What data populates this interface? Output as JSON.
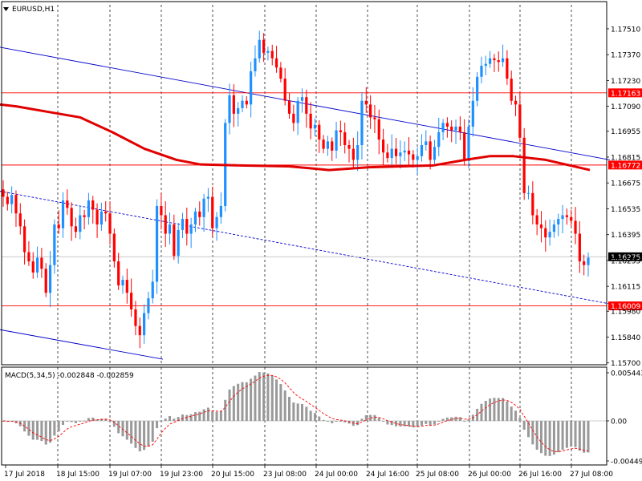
{
  "chart_data": {
    "type": "candlestick",
    "title": "EURUSD,H1",
    "price_axis": {
      "ylim": [
        1.1569,
        1.1764
      ],
      "ticks": [
        "1.17510",
        "1.17370",
        "1.17230",
        "1.17090",
        "1.16955",
        "1.16815",
        "1.16675",
        "1.16535",
        "1.16395",
        "1.16255",
        "1.16115",
        "1.15980",
        "1.15840",
        "1.15700"
      ]
    },
    "time_labels": [
      "17 Jul 2018",
      "18 Jul 15:00",
      "19 Jul 07:00",
      "19 Jul 23:00",
      "20 Jul 15:00",
      "23 Jul 08:00",
      "24 Jul 00:00",
      "24 Jul 16:00",
      "25 Jul 08:00",
      "26 Jul 00:00",
      "26 Jul 16:00",
      "27 Jul 08:00"
    ],
    "hlines": [
      {
        "label": "1.17163",
        "value": 1.17163,
        "color": "#ff0000"
      },
      {
        "label": "1.16772",
        "value": 1.16772,
        "color": "#ff0000"
      },
      {
        "label": "1.16009",
        "value": 1.16009,
        "color": "#ff0000"
      }
    ],
    "current_price": {
      "label": "1.16275",
      "value": 1.16275
    },
    "ma_path": [
      [
        0,
        1.171
      ],
      [
        20,
        1.1709
      ],
      [
        60,
        1.1706
      ],
      [
        100,
        1.1703
      ],
      [
        140,
        1.1695
      ],
      [
        180,
        1.1686
      ],
      [
        220,
        1.168
      ],
      [
        250,
        1.16775
      ],
      [
        300,
        1.1677
      ],
      [
        360,
        1.16765
      ],
      [
        410,
        1.16745
      ],
      [
        460,
        1.1676
      ],
      [
        500,
        1.16765
      ],
      [
        540,
        1.1677
      ],
      [
        580,
        1.168
      ],
      [
        610,
        1.1682
      ],
      [
        640,
        1.1682
      ],
      [
        680,
        1.168
      ],
      [
        710,
        1.1677
      ],
      [
        735,
        1.16745
      ]
    ],
    "channel_upper": [
      [
        0,
        1.1741
      ],
      [
        760,
        1.168
      ]
    ],
    "channel_mid": [
      [
        0,
        1.1663
      ],
      [
        760,
        1.1602
      ]
    ],
    "channel_lower": [
      [
        0,
        1.1588
      ],
      [
        203,
        1.1572
      ]
    ],
    "candles_close": [
      1.166,
      1.1656,
      1.1661,
      1.1651,
      1.1644,
      1.163,
      1.1625,
      1.1619,
      1.1627,
      1.1621,
      1.1608,
      1.1623,
      1.1645,
      1.1643,
      1.1658,
      1.1654,
      1.1644,
      1.1641,
      1.165,
      1.1649,
      1.1658,
      1.1653,
      1.1645,
      1.1652,
      1.1651,
      1.164,
      1.1625,
      1.1612,
      1.1615,
      1.1608,
      1.1599,
      1.159,
      1.1585,
      1.1597,
      1.1605,
      1.1614,
      1.1655,
      1.165,
      1.164,
      1.1645,
      1.1628,
      1.1642,
      1.1648,
      1.164,
      1.1645,
      1.1652,
      1.1649,
      1.1659,
      1.166,
      1.1643,
      1.1649,
      1.1655,
      1.17,
      1.1715,
      1.1705,
      1.1708,
      1.1712,
      1.171,
      1.1728,
      1.1735,
      1.1745,
      1.1738,
      1.1739,
      1.1735,
      1.173,
      1.1724,
      1.1712,
      1.1705,
      1.17,
      1.1712,
      1.1714,
      1.1705,
      1.1697,
      1.1699,
      1.1691,
      1.1686,
      1.169,
      1.1685,
      1.1696,
      1.1695,
      1.1688,
      1.1686,
      1.168,
      1.1688,
      1.1712,
      1.171,
      1.1703,
      1.1702,
      1.1691,
      1.1684,
      1.1681,
      1.1686,
      1.1682,
      1.1684,
      1.1685,
      1.1683,
      1.168,
      1.1682,
      1.1688,
      1.169,
      1.168,
      1.1687,
      1.1695,
      1.17,
      1.1698,
      1.1696,
      1.1698,
      1.1695,
      1.168,
      1.1698,
      1.1712,
      1.1725,
      1.1731,
      1.1732,
      1.1735,
      1.1734,
      1.1733,
      1.1735,
      1.1724,
      1.1712,
      1.171,
      1.1692,
      1.1662,
      1.1662,
      1.165,
      1.1645,
      1.1643,
      1.1638,
      1.1641,
      1.1645,
      1.1648,
      1.165,
      1.1649,
      1.1647,
      1.164,
      1.1625,
      1.1623,
      1.1627
    ]
  },
  "macd": {
    "label": "MACD(5,34,5) -0.002848 -0.002859",
    "ticks": [
      "0.005443",
      "0.00",
      "-0.004494"
    ]
  }
}
